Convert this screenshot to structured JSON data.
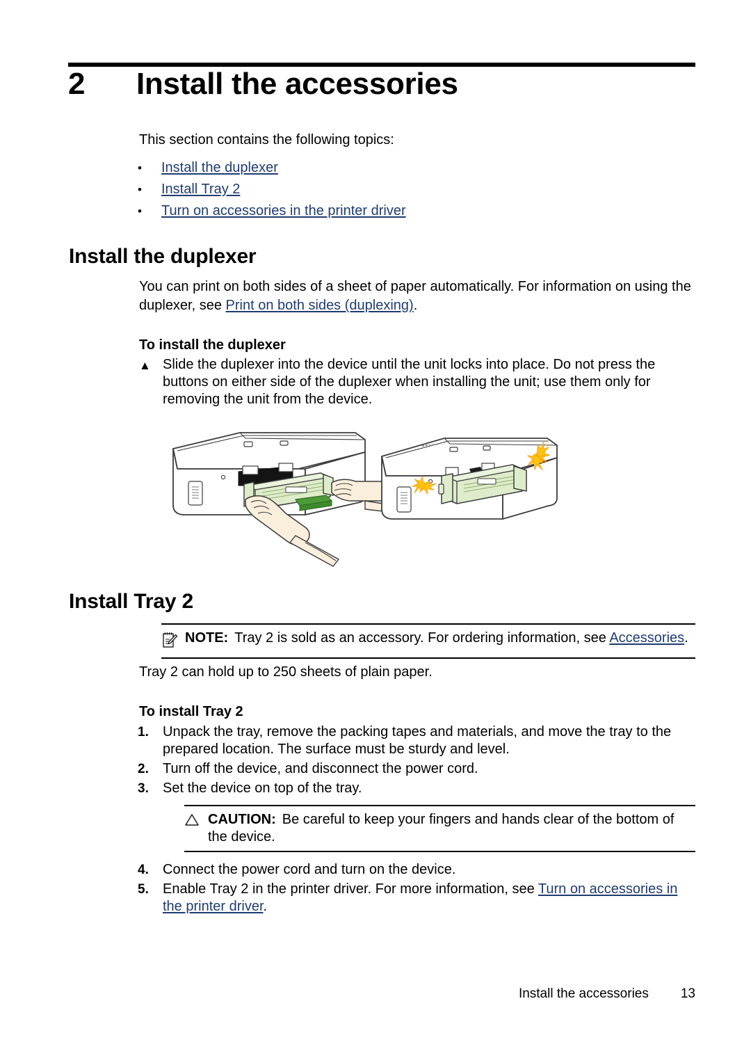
{
  "chapter": {
    "number": "2",
    "title": "Install the accessories"
  },
  "intro": {
    "text": "This section contains the following topics:",
    "bullet_glyph": "•",
    "items": [
      {
        "label": "Install the duplexer"
      },
      {
        "label": "Install Tray 2"
      },
      {
        "label": "Turn on accessories in the printer driver"
      }
    ]
  },
  "duplexer_section": {
    "heading": "Install the duplexer",
    "paragraph_before_link": "You can print on both sides of a sheet of paper automatically. For information on using the duplexer, see ",
    "paragraph_link": "Print on both sides (duplexing)",
    "paragraph_after_link": ".",
    "subheading": "To install the duplexer",
    "step_bullet": "▲",
    "step_text": "Slide the duplexer into the device until the unit locks into place. Do not press the buttons on either side of the duplexer when installing the unit; use them only for removing the unit from the device."
  },
  "figure": {
    "name": "duplexer-installation-illustration",
    "colors": {
      "outline": "#3a3a3a",
      "body": "#ffffff",
      "duplexer_green": "#dfeccb",
      "duplexer_green_dark": "#c6dca8",
      "tab_green": "#4d9b38",
      "skin": "#faeedc",
      "spark_yellow": "#ffd21a",
      "spark_orange": "#f5a013",
      "shadow": "#eeeeee"
    }
  },
  "tray_section": {
    "heading": "Install Tray 2",
    "note": {
      "icon": "note-pad-pencil-icon",
      "label": "NOTE:",
      "text_before_link": "Tray 2 is sold as an accessory. For ordering information, see ",
      "link": "Accessories",
      "text_after_link": "."
    },
    "capacity_text": "Tray 2 can hold up to 250 sheets of plain paper.",
    "subheading": "To install Tray 2",
    "steps_a": [
      {
        "marker": "1.",
        "text": "Unpack the tray, remove the packing tapes and materials, and move the tray to the prepared location. The surface must be sturdy and level."
      },
      {
        "marker": "2.",
        "text": "Turn off the device, and disconnect the power cord."
      },
      {
        "marker": "3.",
        "text": "Set the device on top of the tray."
      }
    ],
    "caution": {
      "icon": "warning-triangle-icon",
      "label": "CAUTION:",
      "text": "Be careful to keep your fingers and hands clear of the bottom of the device."
    },
    "steps_b": [
      {
        "marker": "4.",
        "text": "Connect the power cord and turn on the device.",
        "link": "",
        "text_after_link": ""
      },
      {
        "marker": "5.",
        "text": "Enable Tray 2 in the printer driver. For more information, see ",
        "link": "Turn on accessories in the printer driver",
        "text_after_link": "."
      }
    ]
  },
  "footer": {
    "title": "Install the accessories",
    "page_number": "13"
  },
  "colors": {
    "link": "#1f3c70",
    "text": "#000000",
    "rule": "#000000"
  }
}
